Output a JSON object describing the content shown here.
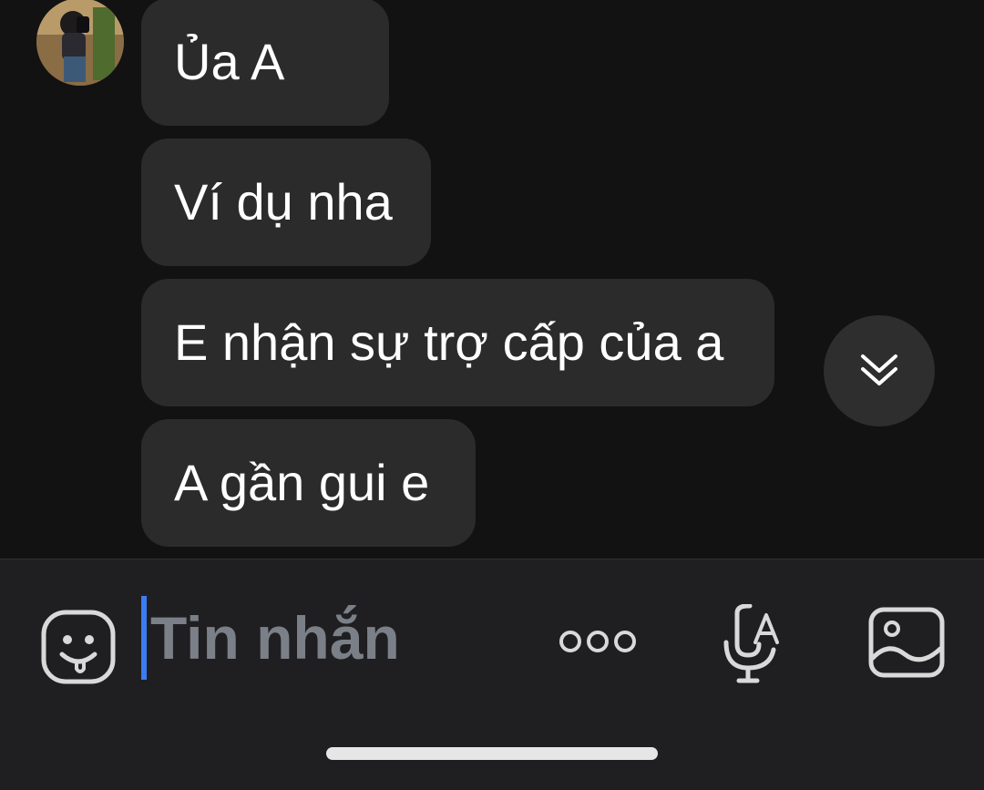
{
  "conversation": {
    "messages": [
      {
        "text": "Ủa A"
      },
      {
        "text": "Ví dụ nha"
      },
      {
        "text": "E nhận sự trợ cấp của a"
      },
      {
        "text": "A gần gui e"
      }
    ]
  },
  "composer": {
    "placeholder": "Tin nhắn",
    "icons": [
      "emoji-icon",
      "more-icon",
      "voice-to-text-icon",
      "image-icon"
    ]
  },
  "colors": {
    "background": "#121212",
    "bubble": "#2b2b2b",
    "composer": "#1f1f21",
    "caret": "#3b7cf2",
    "placeholder": "#7b7f87"
  }
}
